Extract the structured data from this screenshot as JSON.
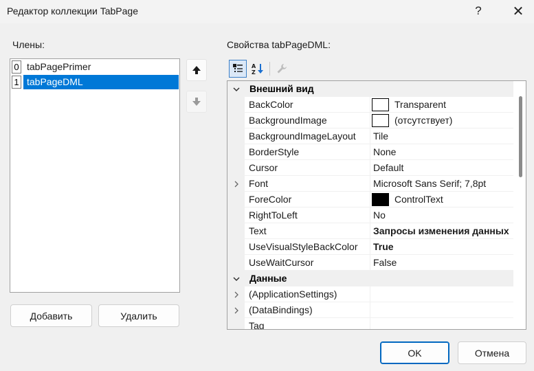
{
  "window": {
    "title": "Редактор коллекции TabPage"
  },
  "members": {
    "label": "Члены:",
    "items": [
      {
        "index": "0",
        "name": "tabPagePrimer",
        "selected": false
      },
      {
        "index": "1",
        "name": "tabPageDML",
        "selected": true
      }
    ],
    "add_button": "Добавить",
    "remove_button": "Удалить"
  },
  "properties": {
    "label": "Свойства tabPageDML:",
    "categories": [
      {
        "name": "Внешний вид",
        "rows": [
          {
            "name": "BackColor",
            "value": "Transparent",
            "swatch": "#ffffff"
          },
          {
            "name": "BackgroundImage",
            "value": "(отсутствует)",
            "swatch": "#ffffff"
          },
          {
            "name": "BackgroundImageLayout",
            "value": "Tile"
          },
          {
            "name": "BorderStyle",
            "value": "None"
          },
          {
            "name": "Cursor",
            "value": "Default"
          },
          {
            "name": "Font",
            "value": "Microsoft Sans Serif; 7,8pt",
            "expandable": true
          },
          {
            "name": "ForeColor",
            "value": "ControlText",
            "swatch": "#000000"
          },
          {
            "name": "RightToLeft",
            "value": "No"
          },
          {
            "name": "Text",
            "value": "Запросы изменения данных",
            "bold": true
          },
          {
            "name": "UseVisualStyleBackColor",
            "value": "True",
            "bold": true
          },
          {
            "name": "UseWaitCursor",
            "value": "False"
          }
        ]
      },
      {
        "name": "Данные",
        "rows": [
          {
            "name": "(ApplicationSettings)",
            "value": "",
            "expandable": true
          },
          {
            "name": "(DataBindings)",
            "value": "",
            "expandable": true
          },
          {
            "name": "Tag",
            "value": ""
          }
        ]
      }
    ]
  },
  "dialog": {
    "ok": "OK",
    "cancel": "Отмена"
  },
  "colors": {
    "selection": "#0078d7",
    "accent_border": "#0067c0"
  }
}
